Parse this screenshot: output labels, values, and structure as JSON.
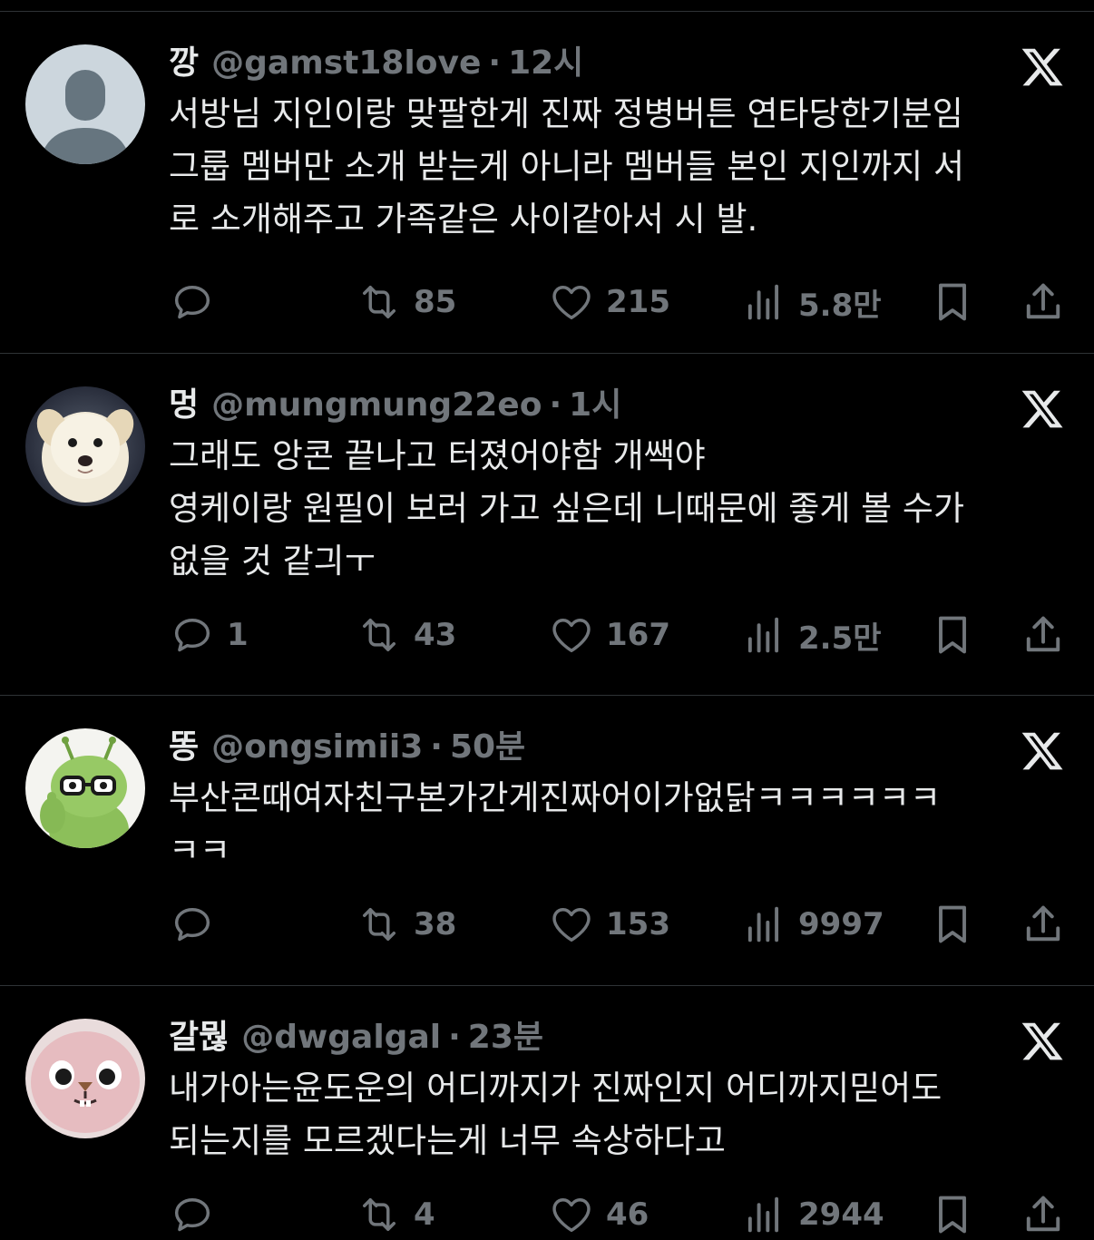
{
  "tweets": [
    {
      "name": "깡",
      "handle": "@gamst18love",
      "time": "12시",
      "text": "서방님 지인이랑 맞팔한게 진짜 정병버튼 연타당한기분임\n그룹 멤버만 소개 받는게 아니라 멤버들 본인 지인까지 서\n로 소개해주고 가족같은 사이같아서 시 발.",
      "replies": "",
      "retweets": "85",
      "likes": "215",
      "views": "5.8만",
      "avatar": "default-avatar-icon"
    },
    {
      "name": "멍",
      "handle": "@mungmung22eo",
      "time": "1시",
      "text": "그래도 앙콘 끝나고 터졌어야함 개쌕야\n영케이랑 원필이 보러 가고 싶은데 니때문에 좋게 볼 수가\n없을 것 같긔ㅜ",
      "replies": "1",
      "retweets": "43",
      "likes": "167",
      "views": "2.5만",
      "avatar": "puppy-avatar"
    },
    {
      "name": "똥",
      "handle": "@ongsimii3",
      "time": "50분",
      "text": "부산콘때여자친구본가간게진짜어이가없닭ㅋㅋㅋㅋㅋㅋ\nㅋㅋ",
      "replies": "",
      "retweets": "38",
      "likes": "153",
      "views": "9997",
      "avatar": "green-character-avatar"
    },
    {
      "name": "갈뭖",
      "handle": "@dwgalgal",
      "time": "23분",
      "text": "내가아는윤도운의 어디까지가 진짜인지 어디까지믿어도\n되는지를 모르겠다는게 너무 속상하다고",
      "replies": "",
      "retweets": "4",
      "likes": "46",
      "views": "2944",
      "avatar": "pink-plush-avatar"
    }
  ],
  "dot": "·",
  "colors": {
    "background": "#000000",
    "text": "#e7e9ea",
    "muted": "#71767b",
    "divider": "#2f3336"
  }
}
